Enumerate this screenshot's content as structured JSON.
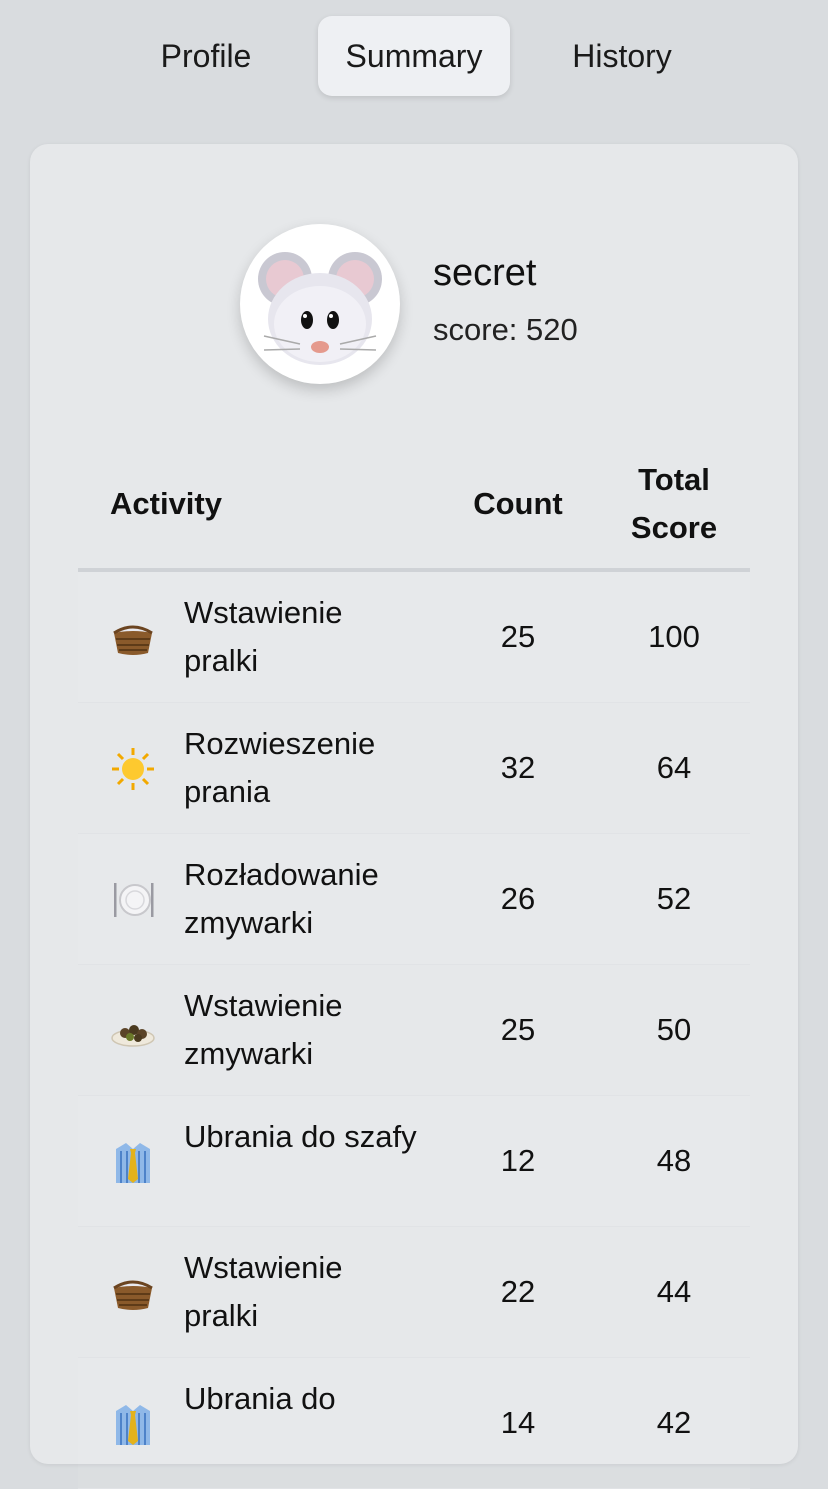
{
  "tabs": [
    {
      "label": "Profile",
      "active": false
    },
    {
      "label": "Summary",
      "active": true
    },
    {
      "label": "History",
      "active": false
    }
  ],
  "user": {
    "name": "secret",
    "score_text": "score: 520",
    "avatar_icon": "mouse-avatar-icon"
  },
  "table": {
    "headers": {
      "activity": "Activity",
      "count": "Count",
      "total_line1": "Total",
      "total_line2": "Score"
    },
    "rows": [
      {
        "icon": "basket-icon",
        "name": "Wstawienie pralki",
        "count": "25",
        "total": "100"
      },
      {
        "icon": "sun-icon",
        "name": "Rozwieszenie prania",
        "count": "32",
        "total": "64"
      },
      {
        "icon": "plate-cutlery-icon",
        "name": "Rozładowanie zmywarki",
        "count": "26",
        "total": "52"
      },
      {
        "icon": "dish-food-icon",
        "name": "Wstawienie zmywarki",
        "count": "25",
        "total": "50"
      },
      {
        "icon": "shirt-tie-icon",
        "name": "Ubrania do szafy",
        "count": "12",
        "total": "48"
      },
      {
        "icon": "basket-icon",
        "name": "Wstawienie pralki",
        "count": "22",
        "total": "44"
      },
      {
        "icon": "shirt-tie-icon",
        "name": "Ubrania do",
        "count": "14",
        "total": "42"
      }
    ]
  }
}
